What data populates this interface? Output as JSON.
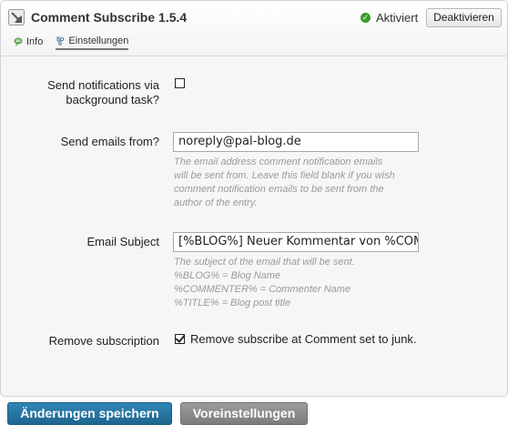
{
  "plugin": {
    "title": "Comment Subscribe 1.5.4",
    "status_label": "Aktiviert",
    "status_color": "#3a9a2b",
    "deactivate_label": "Deaktivieren",
    "icon": "plugin-icon"
  },
  "tabs": [
    {
      "label": "Info",
      "icon": "info-icon",
      "active": false
    },
    {
      "label": "Einstellungen",
      "icon": "settings-icon",
      "active": true
    }
  ],
  "settings": {
    "background_task": {
      "label_line1": "Send notifications via",
      "label_line2": "background task?",
      "checked": false
    },
    "send_from": {
      "label": "Send emails from?",
      "value": "noreply@pal-blog.de",
      "hint": [
        "The email address comment notification emails",
        "will be sent from. Leave this field blank if you wish",
        "comment notification emails to be sent from the",
        "author of the entry."
      ]
    },
    "email_subject": {
      "label": "Email Subject",
      "value": "[%BLOG%] Neuer Kommentar von %COMMENTER%",
      "hint": [
        "The subject of the email that will be sent.",
        "%BLOG% = Blog Name",
        "%COMMENTER% = Commenter Name",
        "%TITLE% = Blog post title"
      ]
    },
    "remove_subscription": {
      "label": "Remove subscription",
      "checkbox_text": "Remove subscribe at Comment set to junk.",
      "checked": true
    }
  },
  "buttons": {
    "save_label": "Änderungen speichern",
    "defaults_label": "Voreinstellungen",
    "save_color": "#2a7aa8"
  }
}
